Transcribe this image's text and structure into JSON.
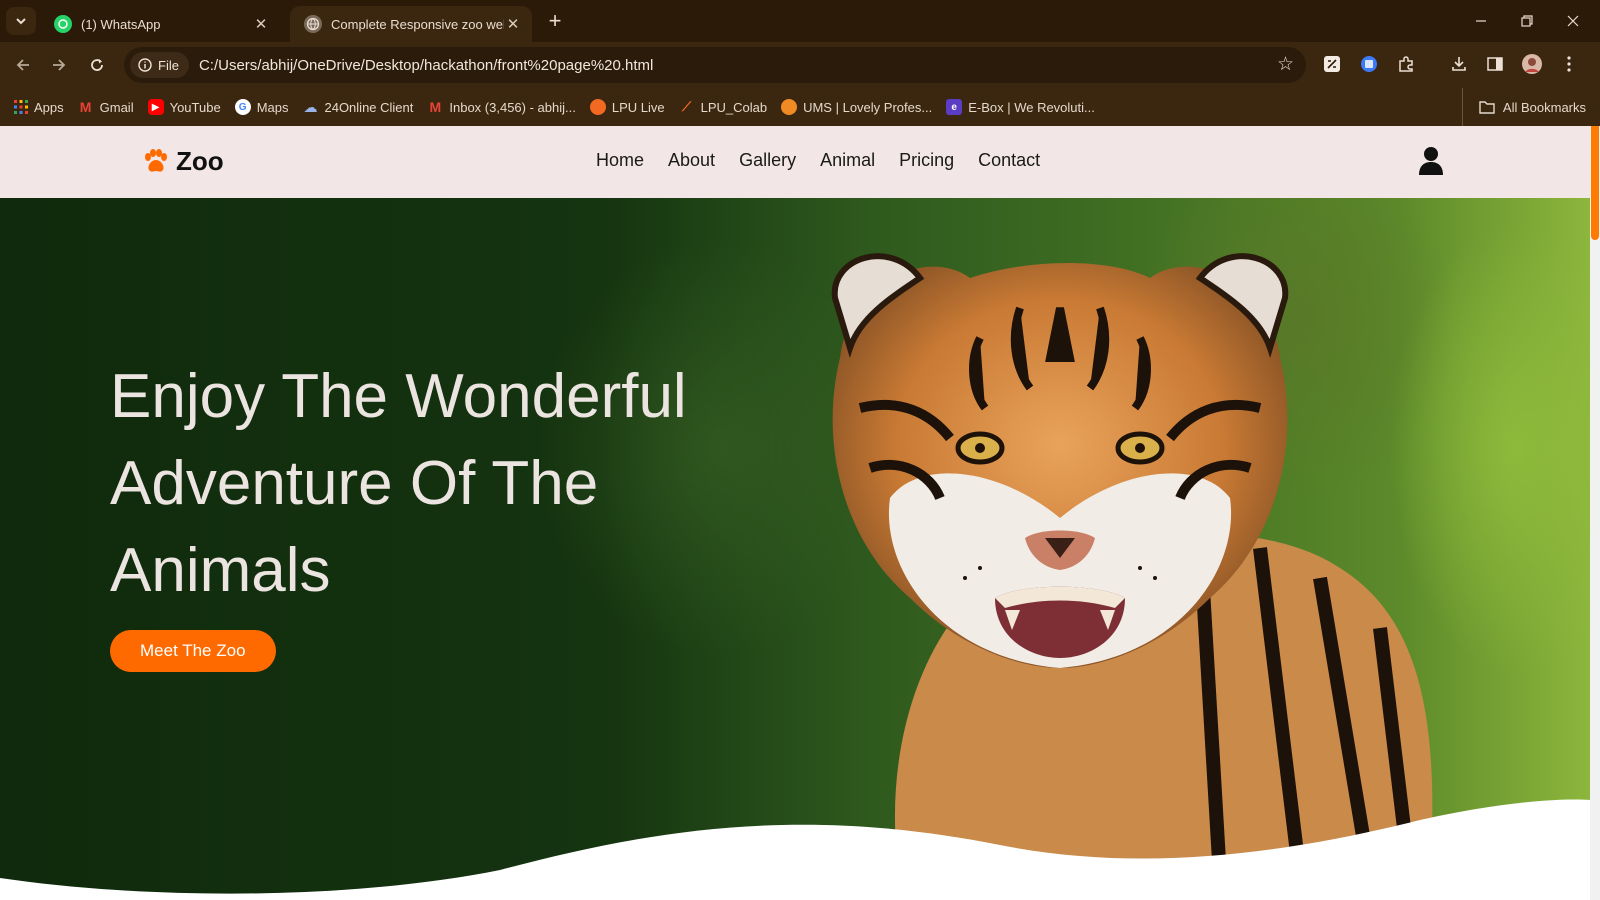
{
  "browser": {
    "tabs": [
      {
        "title": "(1) WhatsApp",
        "active": false
      },
      {
        "title": "Complete Responsive zoo website",
        "active": true
      }
    ],
    "address": {
      "chip": "File",
      "url": "C:/Users/abhij/OneDrive/Desktop/hackathon/front%20page%20.html"
    },
    "bookmarks": [
      {
        "label": "Apps",
        "icon": "apps-grid-icon",
        "color": "#4285f4"
      },
      {
        "label": "Gmail",
        "icon": "gmail-icon",
        "color": "#ea4335"
      },
      {
        "label": "YouTube",
        "icon": "youtube-icon",
        "color": "#ff0000"
      },
      {
        "label": "Maps",
        "icon": "google-icon",
        "color": "#ffffff"
      },
      {
        "label": "24Online Client",
        "icon": "cloud-icon",
        "color": "#9ab4e8"
      },
      {
        "label": "Inbox (3,456) - abhij...",
        "icon": "gmail-icon",
        "color": "#ea4335"
      },
      {
        "label": "LPU Live",
        "icon": "lpu-live-icon",
        "color": "#f26a21"
      },
      {
        "label": "LPU_Colab",
        "icon": "lpu-colab-icon",
        "color": "#f26a21"
      },
      {
        "label": "UMS | Lovely Profes...",
        "icon": "ums-icon",
        "color": "#f08a24"
      },
      {
        "label": "E-Box | We Revoluti...",
        "icon": "ebox-icon",
        "color": "#5b3cc4"
      }
    ],
    "all_bookmarks": "All Bookmarks"
  },
  "site": {
    "logo": "Zoo",
    "nav": [
      "Home",
      "About",
      "Gallery",
      "Animal",
      "Pricing",
      "Contact"
    ],
    "hero": {
      "title": "Enjoy The Wonderful Adventure Of The Animals",
      "button": "Meet The Zoo"
    }
  },
  "colors": {
    "accent": "#ff6a00",
    "header_bg": "#f3e6e6",
    "hero_dark": "#0f2a0c"
  }
}
